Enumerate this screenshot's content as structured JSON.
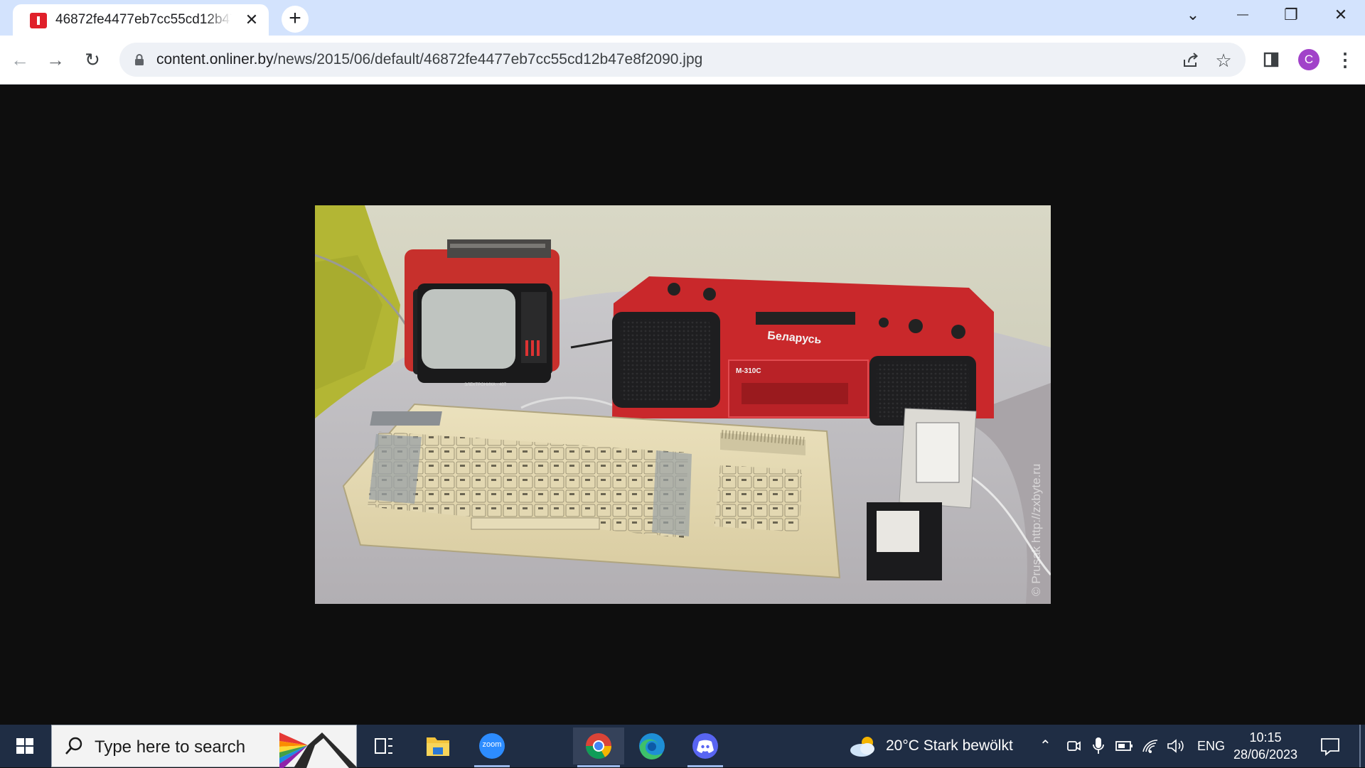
{
  "browser": {
    "tab": {
      "title": "46872fe4477eb7cc55cd12b47e8f2090.jpg",
      "close_glyph": "✕"
    },
    "new_tab_glyph": "+",
    "window_controls": {
      "tab_search_glyph": "⌄",
      "minimize_glyph": "—",
      "restore_glyph": "❐",
      "close_glyph": "✕"
    },
    "toolbar": {
      "back_glyph": "←",
      "forward_glyph": "→",
      "reload_glyph": "↻",
      "url_host": "content.onliner.by",
      "url_path": "/news/2015/06/default/46872fe4477eb7cc55cd12b47e8f2090.jpg",
      "share_icon": "share-icon",
      "bookmark_glyph": "☆",
      "side_panel_icon": "side-panel-icon",
      "profile_initial": "C",
      "menu_glyph": "⋮"
    },
    "colors": {
      "tabstrip": "#d3e3fd",
      "page_background": "#0e0e0e",
      "profile": "#a142c9"
    }
  },
  "image": {
    "watermark": "© Prusak  http://zxbyte.ru",
    "tv_label": "ЭЛЕКТРОНИКА - 407",
    "radio_brand": "Беларусь",
    "radio_model": "М-310С"
  },
  "taskbar": {
    "search_placeholder": "Type here to search",
    "apps": [
      "task-view",
      "file-explorer",
      "zoom",
      "chrome",
      "edge",
      "discord"
    ],
    "zoom_label": "zoom",
    "weather": "20°C  Stark bewölkt",
    "language": "ENG",
    "time": "10:15",
    "date": "28/06/2023"
  }
}
